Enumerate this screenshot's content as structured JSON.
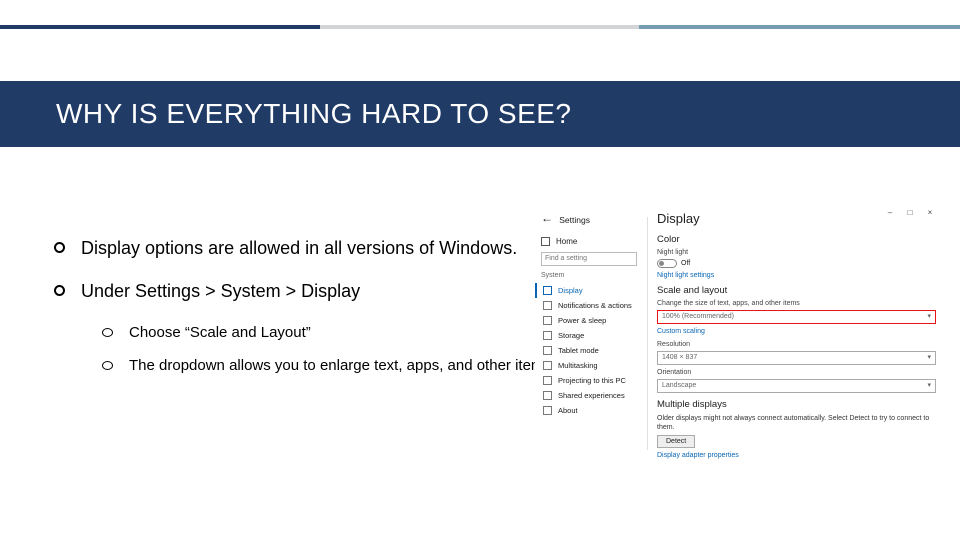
{
  "accent_colors": {
    "navy": "#1f3b66",
    "gray": "#d3d4d6",
    "teal": "#769cb1"
  },
  "title": "WHY IS EVERYTHING HARD TO SEE?",
  "bullets": [
    {
      "text": "Display options are allowed in all versions of Windows."
    },
    {
      "text": "Under Settings > System > Display",
      "sub": [
        {
          "text": "Choose “Scale and Layout”"
        },
        {
          "text": "The dropdown allows you to enlarge text, apps, and other items."
        }
      ]
    }
  ],
  "settings": {
    "window_title": "Settings",
    "window_controls": {
      "min": "–",
      "max": "□",
      "close": "×"
    },
    "home": "Home",
    "search_placeholder": "Find a setting",
    "category_label": "System",
    "nav": [
      {
        "label": "Display",
        "selected": true
      },
      {
        "label": "Notifications & actions"
      },
      {
        "label": "Power & sleep"
      },
      {
        "label": "Storage"
      },
      {
        "label": "Tablet mode"
      },
      {
        "label": "Multitasking"
      },
      {
        "label": "Projecting to this PC"
      },
      {
        "label": "Shared experiences"
      },
      {
        "label": "About"
      }
    ],
    "page_title": "Display",
    "color_head": "Color",
    "night_label": "Night light",
    "night_state": "Off",
    "night_link": "Night light settings",
    "scale_head": "Scale and layout",
    "scale_label": "Change the size of text, apps, and other items",
    "scale_value": "100% (Recommended)",
    "custom_link": "Custom scaling",
    "res_label": "Resolution",
    "res_value": "1408 × 837",
    "orient_label": "Orientation",
    "orient_value": "Landscape",
    "multi_head": "Multiple displays",
    "multi_para": "Older displays might not always connect automatically. Select Detect to try to connect to them.",
    "detect_btn": "Detect",
    "adapter_link": "Display adapter properties"
  }
}
